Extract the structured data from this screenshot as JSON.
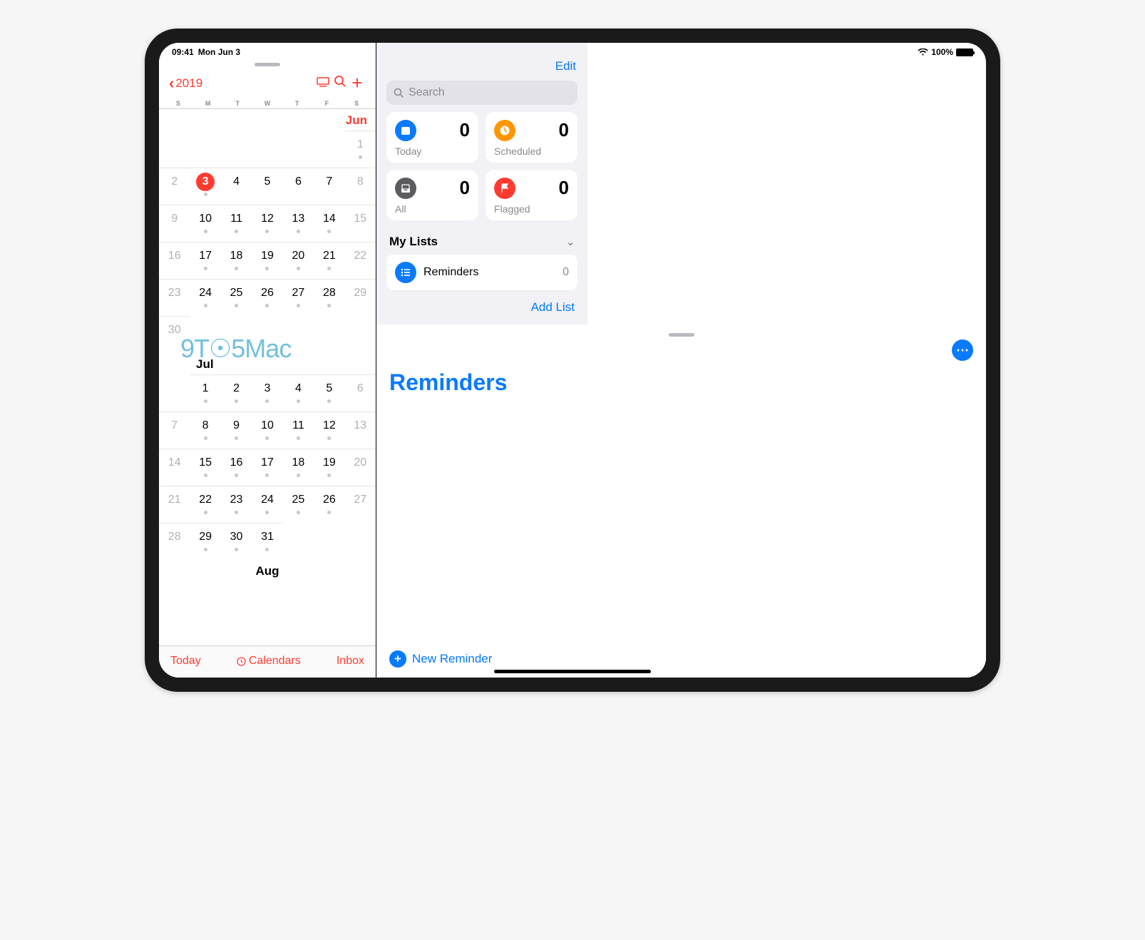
{
  "status": {
    "time": "09:41",
    "date": "Mon Jun 3",
    "battery": "100%"
  },
  "calendar": {
    "back": "2019",
    "dow": [
      "S",
      "M",
      "T",
      "W",
      "T",
      "F",
      "S"
    ],
    "today_btn": "Today",
    "calendars_btn": "Calendars",
    "inbox_btn": "Inbox",
    "months": [
      {
        "name": "Jun",
        "align": "right",
        "start": 6,
        "days": [
          {
            "n": 1,
            "dot": true,
            "we": true
          },
          {
            "n": 2,
            "we": true
          },
          {
            "n": 3,
            "today": true,
            "dot": true
          },
          {
            "n": 4
          },
          {
            "n": 5
          },
          {
            "n": 6
          },
          {
            "n": 7
          },
          {
            "n": 8,
            "we": true
          },
          {
            "n": 9,
            "we": true
          },
          {
            "n": 10,
            "dot": true
          },
          {
            "n": 11,
            "dot": true
          },
          {
            "n": 12,
            "dot": true
          },
          {
            "n": 13,
            "dot": true
          },
          {
            "n": 14,
            "dot": true
          },
          {
            "n": 15,
            "we": true
          },
          {
            "n": 16,
            "we": true
          },
          {
            "n": 17,
            "dot": true
          },
          {
            "n": 18,
            "dot": true
          },
          {
            "n": 19,
            "dot": true
          },
          {
            "n": 20,
            "dot": true
          },
          {
            "n": 21,
            "dot": true
          },
          {
            "n": 22,
            "we": true
          },
          {
            "n": 23,
            "we": true
          },
          {
            "n": 24,
            "dot": true
          },
          {
            "n": 25,
            "dot": true
          },
          {
            "n": 26,
            "dot": true
          },
          {
            "n": 27,
            "dot": true
          },
          {
            "n": 28,
            "dot": true
          },
          {
            "n": 29,
            "we": true
          },
          {
            "n": 30,
            "we": true
          }
        ]
      },
      {
        "name": "Jul",
        "align": "left",
        "start": 1,
        "days": [
          {
            "n": 1,
            "dot": true
          },
          {
            "n": 2,
            "dot": true
          },
          {
            "n": 3,
            "dot": true
          },
          {
            "n": 4,
            "dot": true
          },
          {
            "n": 5,
            "dot": true
          },
          {
            "n": 6,
            "we": true
          },
          {
            "n": 7,
            "we": true
          },
          {
            "n": 8,
            "dot": true
          },
          {
            "n": 9,
            "dot": true
          },
          {
            "n": 10,
            "dot": true
          },
          {
            "n": 11,
            "dot": true
          },
          {
            "n": 12,
            "dot": true
          },
          {
            "n": 13,
            "we": true
          },
          {
            "n": 14,
            "we": true
          },
          {
            "n": 15,
            "dot": true
          },
          {
            "n": 16,
            "dot": true
          },
          {
            "n": 17,
            "dot": true
          },
          {
            "n": 18,
            "dot": true
          },
          {
            "n": 19,
            "dot": true
          },
          {
            "n": 20,
            "we": true
          },
          {
            "n": 21,
            "we": true
          },
          {
            "n": 22,
            "dot": true
          },
          {
            "n": 23,
            "dot": true
          },
          {
            "n": 24,
            "dot": true
          },
          {
            "n": 25,
            "dot": true
          },
          {
            "n": 26,
            "dot": true
          },
          {
            "n": 27,
            "we": true
          },
          {
            "n": 28,
            "we": true
          },
          {
            "n": 29,
            "dot": true
          },
          {
            "n": 30,
            "dot": true
          },
          {
            "n": 31,
            "dot": true
          }
        ]
      },
      {
        "name": "Aug",
        "align": "center",
        "start": 0,
        "days": []
      }
    ]
  },
  "reminders": {
    "edit": "Edit",
    "search_placeholder": "Search",
    "cards": [
      {
        "key": "today",
        "label": "Today",
        "count": 0,
        "cls": "ic-today",
        "glyph": "calendar"
      },
      {
        "key": "scheduled",
        "label": "Scheduled",
        "count": 0,
        "cls": "ic-sched",
        "glyph": "clock"
      },
      {
        "key": "all",
        "label": "All",
        "count": 0,
        "cls": "ic-all",
        "glyph": "tray"
      },
      {
        "key": "flagged",
        "label": "Flagged",
        "count": 0,
        "cls": "ic-flag",
        "glyph": "flag"
      }
    ],
    "lists_header": "My Lists",
    "lists": [
      {
        "name": "Reminders",
        "count": 0
      }
    ],
    "add_list": "Add List",
    "title": "Reminders",
    "new_reminder": "New Reminder"
  },
  "watermark": "9T☉5Mac"
}
